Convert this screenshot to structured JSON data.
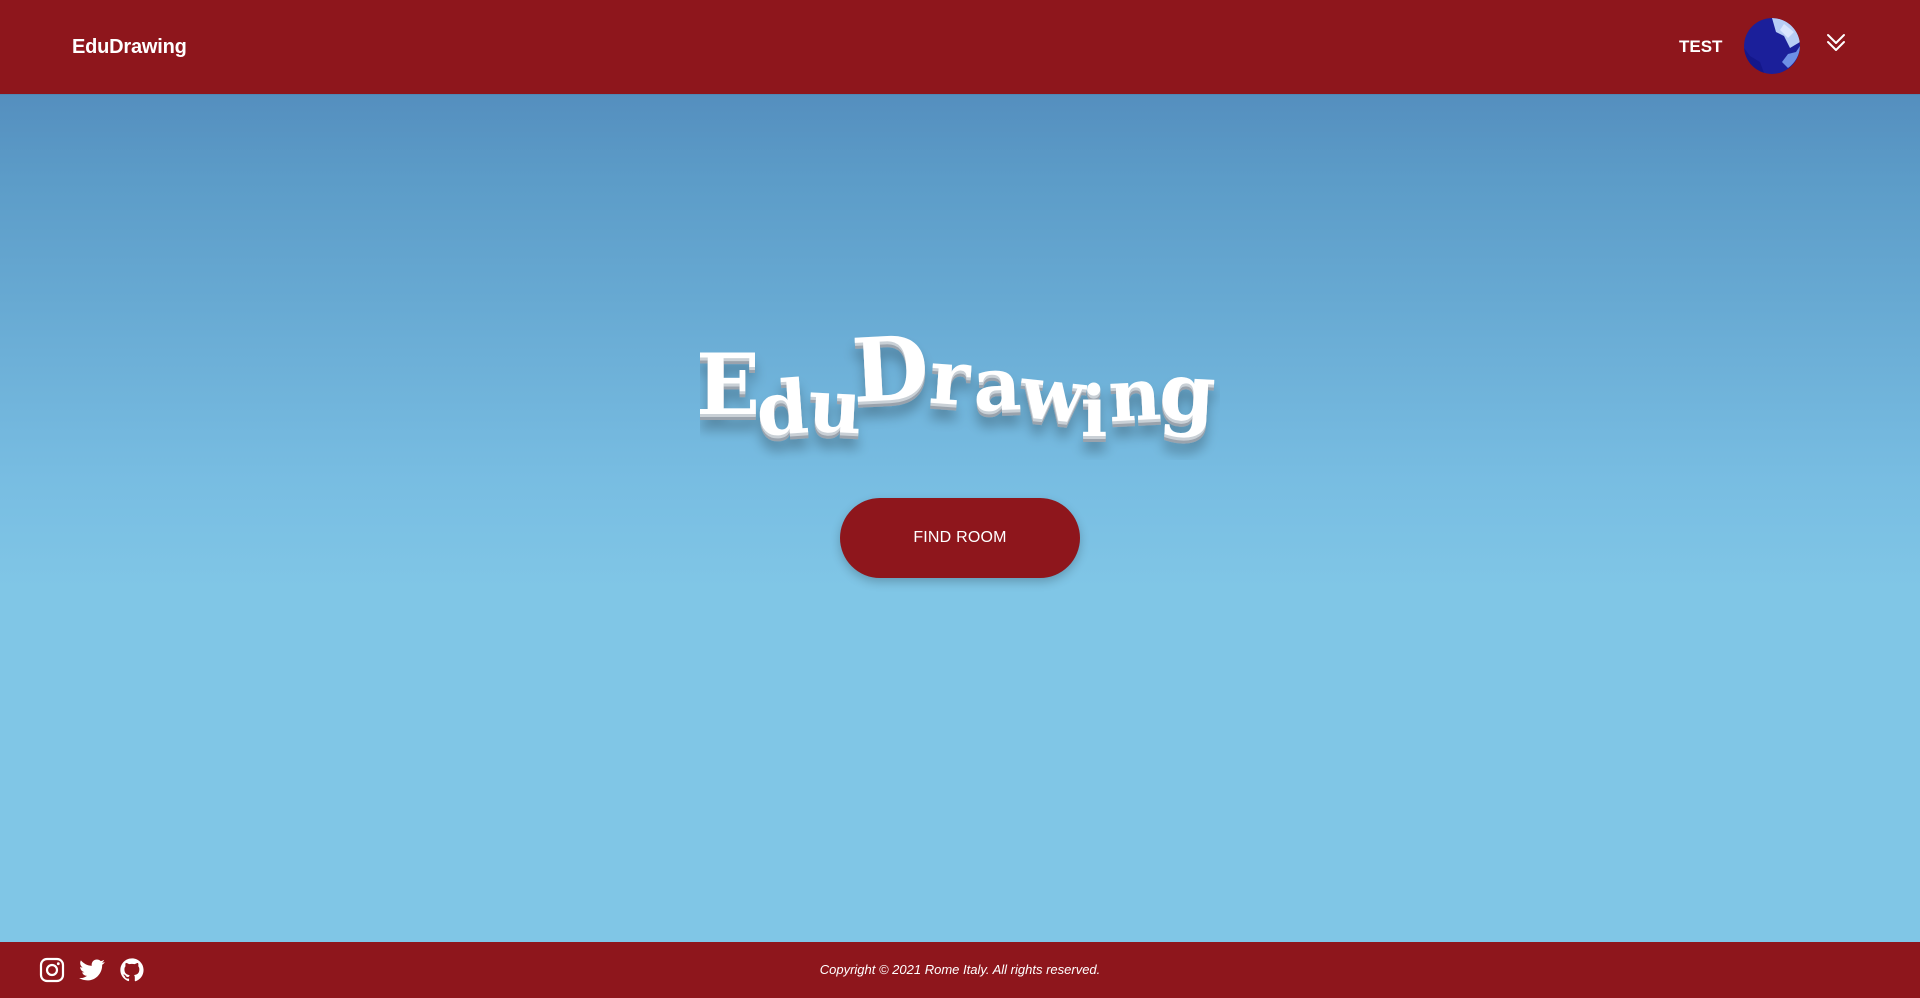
{
  "header": {
    "brand": "EduDrawing",
    "username": "TEST"
  },
  "hero": {
    "logo_letters": [
      "E",
      "d",
      "u",
      "D",
      "r",
      "a",
      "w",
      "i",
      "n",
      "g"
    ],
    "button_label": "FIND ROOM"
  },
  "footer": {
    "copyright": "Copyright © 2021 Rome Italy. All rights reserved.",
    "social_icons": [
      "instagram-icon",
      "twitter-icon",
      "github-icon"
    ]
  },
  "colors": {
    "brand_red": "#8e161c",
    "sky_top": "#4c80b4",
    "sky_bottom": "#80c6e6",
    "logo_text": "#ffffff"
  }
}
